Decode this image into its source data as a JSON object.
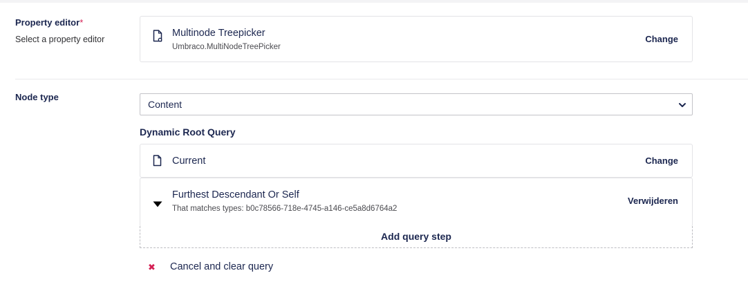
{
  "property_editor": {
    "label": "Property editor",
    "required_mark": "*",
    "description": "Select a property editor",
    "card": {
      "icon": "document-settings-icon",
      "name": "Multinode Treepicker",
      "alias": "Umbraco.MultiNodeTreePicker",
      "action_label": "Change"
    }
  },
  "node_type": {
    "label": "Node type",
    "select": {
      "selected": "Content",
      "options": [
        "Content"
      ]
    },
    "dynamic_root": {
      "title": "Dynamic Root Query",
      "origin": {
        "icon": "document-icon",
        "label": "Current",
        "action_label": "Change"
      },
      "steps": [
        {
          "icon": "caret-down-icon",
          "label": "Furthest Descendant Or Self",
          "detail": "That matches types: b0c78566-718e-4745-a146-ce5a8d6764a2",
          "action_label": "Verwijderen"
        }
      ],
      "add_step_label": "Add query step",
      "cancel_label": "Cancel and clear query"
    }
  },
  "colors": {
    "text": "#1b264f",
    "required": "#d42054",
    "border": "#e3e3e6",
    "background": "#f3f3f5"
  }
}
